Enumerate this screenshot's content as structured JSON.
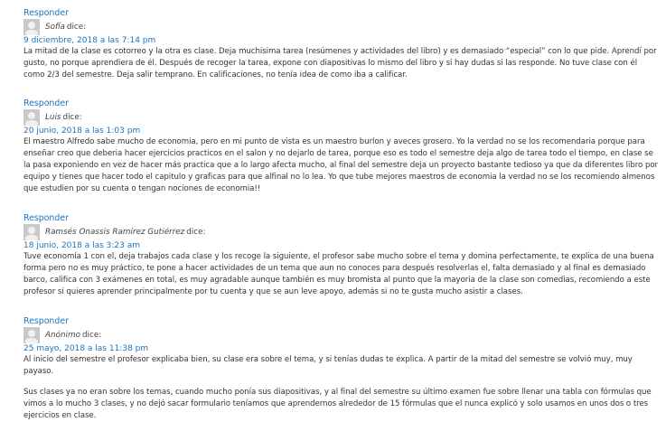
{
  "reply_label": "Responder",
  "says_label": "dice:",
  "comments": [
    {
      "author": "Sofía",
      "date": "9 diciembre, 2018 a las 7:14 pm",
      "paragraphs": [
        "La mitad de la clase es cotorreo y la otra es clase. Deja muchisima tarea (resúmenes y actividades del libro) y es demasiado “especial” con lo que pide. Aprendí por gusto, no porque aprendiera de él. Después de recoger la tarea, expone con diapositivas lo mismo del libro y si hay dudas si las responde. No tuve clase con él como 2/3 del semestre. Deja salir temprano. En calificaciones, no tenía idea de como iba a calificar."
      ]
    },
    {
      "author": "Luis",
      "date": "20 junio, 2018 a las 1:03 pm",
      "paragraphs": [
        "El maestro Alfredo sabe mucho de economia, pero en mi punto de vista es un maestro burlon y aveces grosero. Yo la verdad no se los recomendaria porque para enseñar creo que deberia hacer ejercicios practicos en el salon y no dejarlo de tarea, porque eso es todo el semestre deja algo de tarea todo el tiempo, en clase se la pasa exponiendo en vez de hacer más practica que a lo largo afecta mucho, al final del semestre deja un proyecto bastante tedioso ya que da diferentes libro por equipo y tienes que hacer todo el capitulo y graficas para que alfinal no lo lea. Yo que tube mejores maestros de economia la verdad no se los recomiendo almenos que estudien por su cuenta o tengan nociones de economia!!"
      ]
    },
    {
      "author": "Ramsés Onassis Ramírez Gutiérrez",
      "date": "18 junio, 2018 a las 3:23 am",
      "paragraphs": [
        "Tuve economía 1 con el, deja trabajos cada clase y los recoge la siguiente, el profesor sabe mucho sobre el tema y domina perfectamente, te explica de una buena forma pero no es muy práctico, te pone a hacer actividades de un tema que aun no conoces para después resolverlas el, falta demasiado y al final es demasiado barco, califica con 3 exámenes en total, es muy agradable aunque también es muy bromista al punto que la mayoria de la clase son comedias, recomiendo a este profesor si quieres aprender principalmente por tu cuenta y que se aun leve apoyo, además si no te gusta mucho asistir a clases."
      ]
    },
    {
      "author": "Anónimo",
      "date": "25 mayo, 2018 a las 11:38 pm",
      "paragraphs": [
        "Al inicio del semestre el profesor explicaba bien, su clase era sobre el tema, y si tenías dudas te explica. A partir de la mitad del semestre se volvió muy, muy payaso.",
        "Sus clases ya no eran sobre los temas, cuando mucho ponía sus diapositivas, y al final del semestre su último examen fue sobre llenar una tabla con fórmulas que vimos a lo mucho 3 clases, y no dejó sacar formulario teníamos que aprendernos alrededor de 15 fórmulas que el nunca explicó y solo usamos en unos dos o tres ejercicios en clase."
      ]
    }
  ]
}
